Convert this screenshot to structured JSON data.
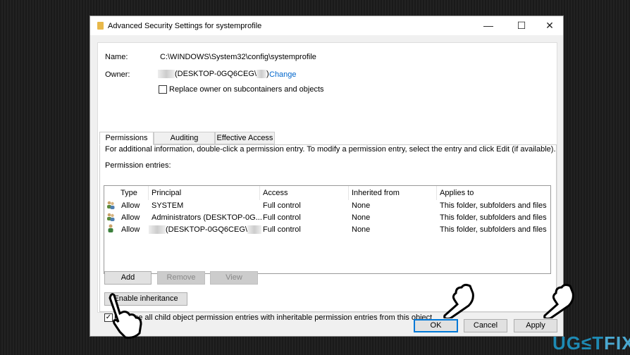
{
  "window": {
    "title": "Advanced Security Settings for systemprofile",
    "minimize": "—",
    "maximize": "☐",
    "close": "✕"
  },
  "name_label": "Name:",
  "name_value": "C:\\WINDOWS\\System32\\config\\systemprofile",
  "owner_label": "Owner:",
  "owner_value": "(DESKTOP-0GQ6CEG\\",
  "owner_suffix": ")",
  "change_link": "Change",
  "replace_owner": {
    "label": "Replace owner on subcontainers and objects",
    "checked": false
  },
  "tabs": [
    {
      "label": "Permissions",
      "selected": true
    },
    {
      "label": "Auditing"
    },
    {
      "label": "Effective Access"
    }
  ],
  "info_text": "For additional information, double-click a permission entry. To modify a permission entry, select the entry and click Edit (if available).",
  "entries_label": "Permission entries:",
  "columns": [
    "Type",
    "Principal",
    "Access",
    "Inherited from",
    "Applies to"
  ],
  "rows": [
    {
      "icon": "group-users-icon",
      "type": "Allow",
      "principal": "SYSTEM",
      "access": "Full control",
      "inherited": "None",
      "applies": "This folder, subfolders and files"
    },
    {
      "icon": "group-users-icon",
      "type": "Allow",
      "principal": "Administrators (DESKTOP-0G...",
      "access": "Full control",
      "inherited": "None",
      "applies": "This folder, subfolders and files"
    },
    {
      "icon": "user-icon",
      "type": "Allow",
      "principal": "(DESKTOP-0GQ6CEG\\",
      "access": "Full control",
      "inherited": "None",
      "applies": "This folder, subfolders and files"
    }
  ],
  "buttons": {
    "add": "Add",
    "remove": "Remove",
    "view": "View",
    "enable_inheritance": "Enable inheritance",
    "ok": "OK",
    "cancel": "Cancel",
    "apply": "Apply"
  },
  "replace_child": {
    "label": "Replace all child object permission entries with inheritable permission entries from this object",
    "checked": true
  },
  "logo": "UG≤TFIX",
  "colors": {
    "link": "#0066cc",
    "accent": "#0078d7",
    "logo_blue": "#1e8ab4"
  }
}
